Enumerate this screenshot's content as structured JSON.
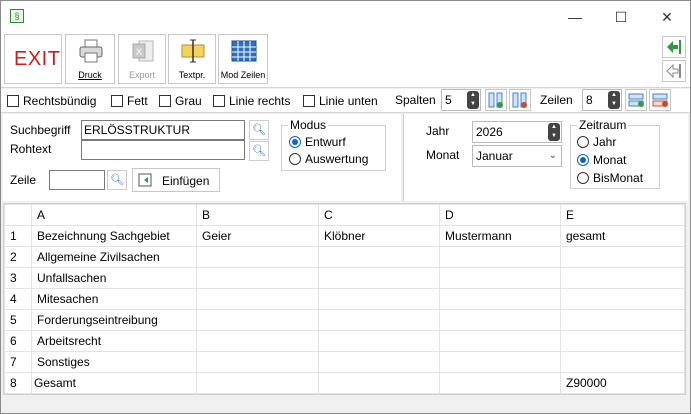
{
  "titlebar": {
    "app_icon": "§",
    "minimize": "—",
    "maximize": "☐",
    "close": "✕"
  },
  "toolbar": {
    "exit": "EXIT",
    "druck": "Druck",
    "export": "Export",
    "textpr": "Textpr.",
    "modzeilen": "Mod Zeilen"
  },
  "options": {
    "rechtsbuendig": "Rechtsbündig",
    "fett": "Fett",
    "grau": "Grau",
    "linie_rechts": "Linie rechts",
    "linie_unten": "Linie unten",
    "spalten_label": "Spalten",
    "spalten_value": "5",
    "zeilen_label": "Zeilen",
    "zeilen_value": "8"
  },
  "search": {
    "suchbegriff_label": "Suchbegriff",
    "suchbegriff_value": "ERLÖSSTRUKTUR",
    "rohtext_label": "Rohtext",
    "rohtext_value": "",
    "zeile_label": "Zeile",
    "zeile_value": "",
    "einfuegen": "Einfügen"
  },
  "modus": {
    "title": "Modus",
    "entwurf": "Entwurf",
    "auswertung": "Auswertung",
    "selected": "Entwurf"
  },
  "period": {
    "jahr_label": "Jahr",
    "jahr_value": "2026",
    "monat_label": "Monat",
    "monat_value": "Januar"
  },
  "zeitraum": {
    "title": "Zeitraum",
    "jahr": "Jahr",
    "monat": "Monat",
    "bismonat": "BisMonat",
    "selected": "Monat"
  },
  "grid": {
    "columns": [
      "A",
      "B",
      "C",
      "D",
      "E"
    ],
    "rows": [
      {
        "n": "1",
        "cells": [
          "Bezeichnung Sachgebiet",
          "Geier",
          "Klöbner",
          "Mustermann",
          "gesamt"
        ]
      },
      {
        "n": "2",
        "cells": [
          "Allgemeine Zivilsachen",
          "",
          "",
          "",
          ""
        ]
      },
      {
        "n": "3",
        "cells": [
          "Unfallsachen",
          "",
          "",
          "",
          ""
        ]
      },
      {
        "n": "4",
        "cells": [
          "Mitesachen",
          "",
          "",
          "",
          ""
        ]
      },
      {
        "n": "5",
        "cells": [
          "Forderungseintreibung",
          "",
          "",
          "",
          ""
        ]
      },
      {
        "n": "6",
        "cells": [
          "Arbeitsrecht",
          "",
          "",
          "",
          ""
        ]
      },
      {
        "n": "7",
        "cells": [
          "Sonstiges",
          "",
          "",
          "",
          ""
        ]
      },
      {
        "n": "8",
        "cells": [
          "Gesamt",
          "",
          "",
          "",
          "Z90000"
        ]
      }
    ]
  }
}
